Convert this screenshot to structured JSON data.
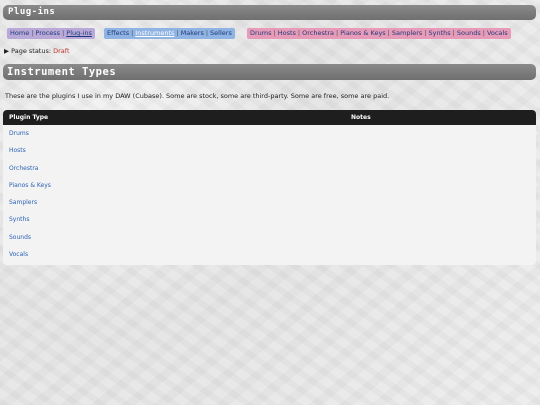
{
  "page": {
    "title": "Plug-ins",
    "section_title": "Instrument Types",
    "status_label": "Page status:",
    "status_value": "Draft",
    "intro": "These are the plugins I use in my DAW (Cubase). Some are stock, some are third-party. Some are free, some are paid."
  },
  "nav": {
    "group1": [
      "Home",
      "Process",
      "Plug-ins"
    ],
    "group2": [
      "Effects",
      "Instruments",
      "Makers",
      "Sellers"
    ],
    "group3": [
      "Drums",
      "Hosts",
      "Orchestra",
      "Pianos & Keys",
      "Samplers",
      "Synths",
      "Sounds",
      "Vocals"
    ]
  },
  "table": {
    "headers": [
      "Plugin Type",
      "Notes"
    ],
    "rows": [
      "Drums",
      "Hosts",
      "Orchestra",
      "Pianos & Keys",
      "Samplers",
      "Synths",
      "Sounds",
      "Vocals"
    ]
  }
}
